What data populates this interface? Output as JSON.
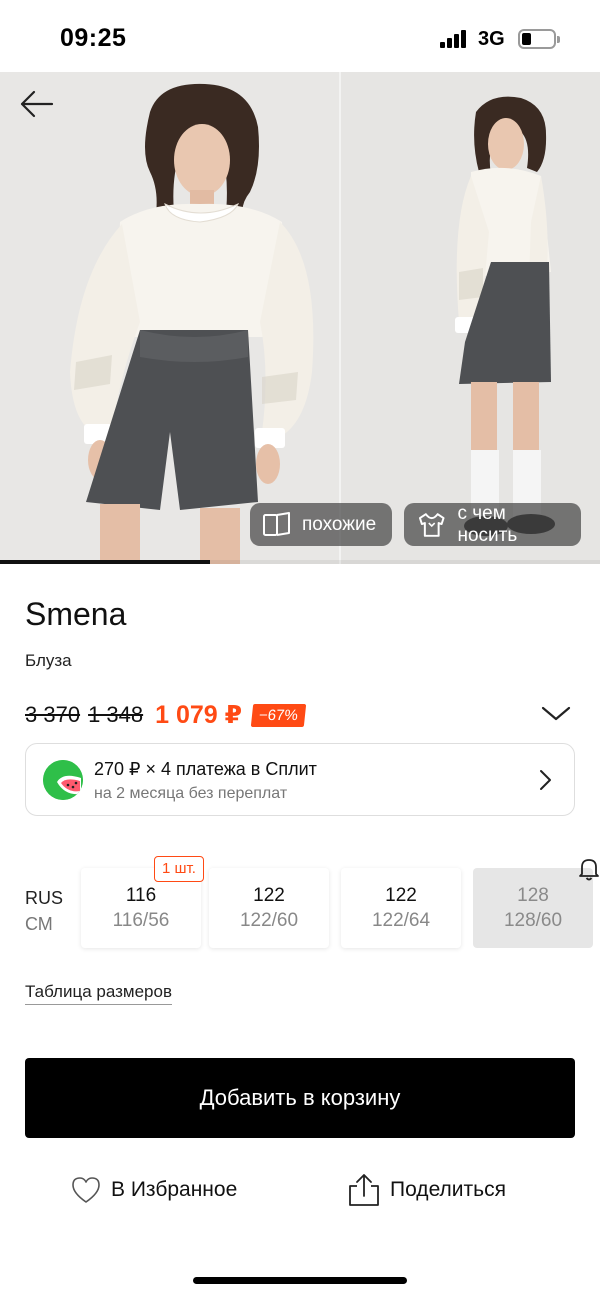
{
  "status_bar": {
    "time": "09:25",
    "network": "3G",
    "icons": [
      "signal-icon",
      "battery-icon"
    ]
  },
  "gallery": {
    "photo_count_visible": 2,
    "photo_1_desc": "",
    "progress_fraction": 0.35,
    "chips": {
      "similar": {
        "label": "похожие",
        "icon": "similar-icon"
      },
      "outfit": {
        "label": "с чем носить",
        "icon": "clothes-icon"
      }
    }
  },
  "product": {
    "brand": "Smena",
    "type": "Блуза",
    "price": {
      "old_1": "3 370",
      "old_2": "1 348",
      "current": "1 079 ₽",
      "discount": "−67%"
    }
  },
  "split": {
    "title": "270 ₽ × 4 платежа в Сплит",
    "subtitle": "на 2 месяца без переплат",
    "accent": "#2fbf49"
  },
  "sizes": {
    "label_rus": "RUS",
    "label_cm": "СМ",
    "stock_badge": "1 шт.",
    "items": [
      {
        "rus": "116",
        "cm": "116/56",
        "available": true
      },
      {
        "rus": "122",
        "cm": "122/60",
        "available": true
      },
      {
        "rus": "122",
        "cm": "122/64",
        "available": true
      },
      {
        "rus": "128",
        "cm": "128/60",
        "available": false
      }
    ]
  },
  "size_table_link": "Таблица размеров",
  "add_to_cart": "Добавить в корзину",
  "actions": {
    "favorite": "В Избранное",
    "share": "Поделиться"
  },
  "colors": {
    "accent_orange": "#ff4a14",
    "primary_black": "#000000"
  }
}
